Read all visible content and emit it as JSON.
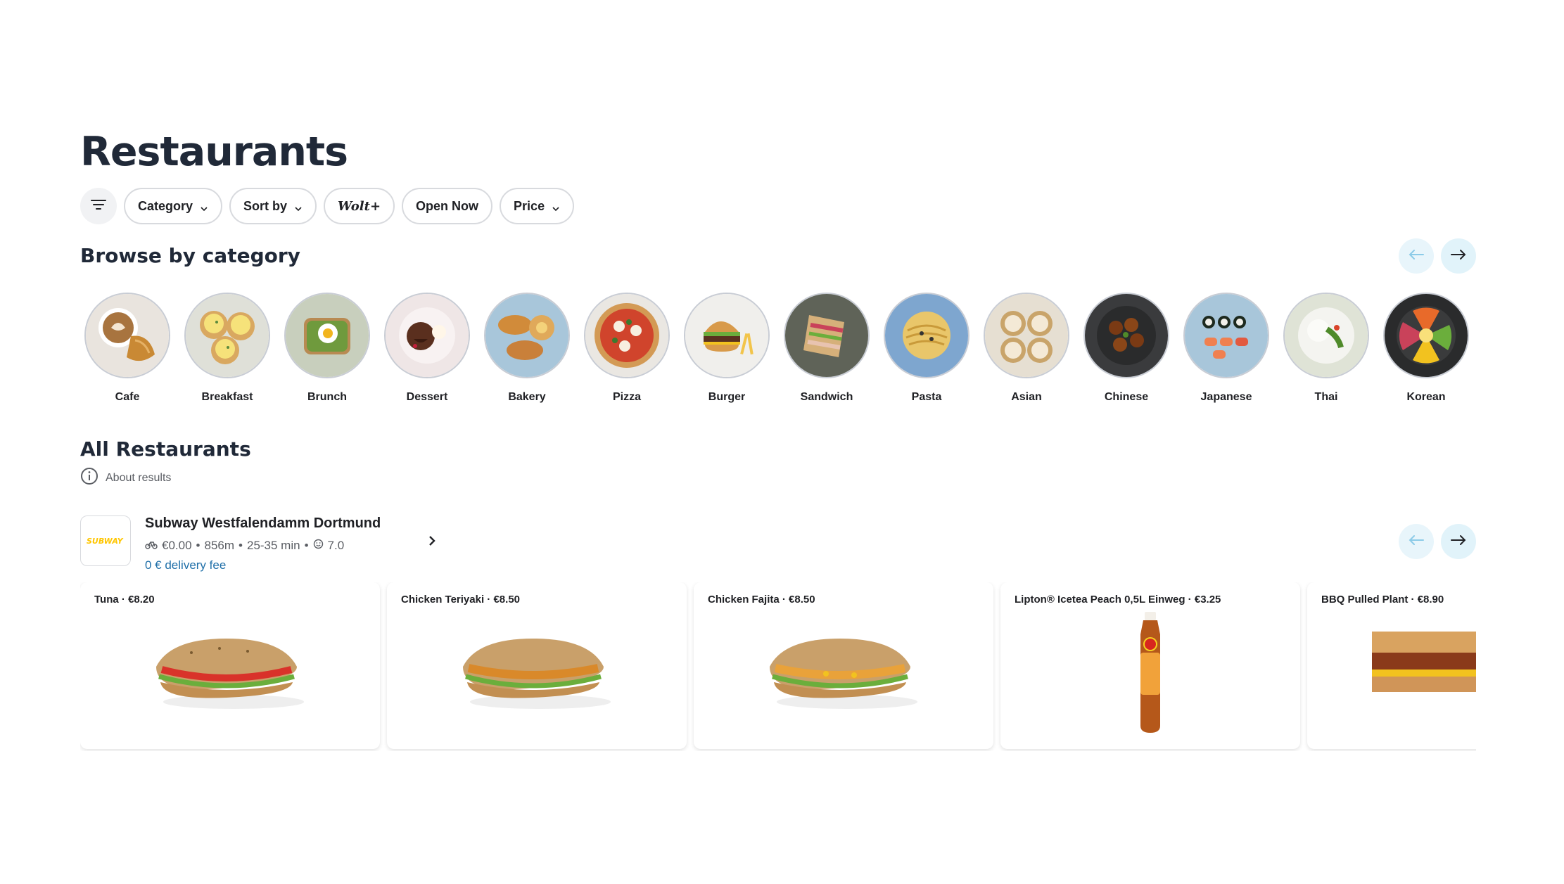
{
  "page": {
    "title": "Restaurants"
  },
  "filters": {
    "icon": "filter-lines-icon",
    "chips": [
      {
        "label": "Category",
        "has_dropdown": true
      },
      {
        "label": "Sort by",
        "has_dropdown": true
      },
      {
        "label": "Wolt+",
        "has_dropdown": false
      },
      {
        "label": "Open Now",
        "has_dropdown": false
      },
      {
        "label": "Price",
        "has_dropdown": true
      }
    ]
  },
  "browse": {
    "title": "Browse by category",
    "categories": [
      {
        "label": "Cafe"
      },
      {
        "label": "Breakfast"
      },
      {
        "label": "Brunch"
      },
      {
        "label": "Dessert"
      },
      {
        "label": "Bakery"
      },
      {
        "label": "Pizza"
      },
      {
        "label": "Burger"
      },
      {
        "label": "Sandwich"
      },
      {
        "label": "Pasta"
      },
      {
        "label": "Asian"
      },
      {
        "label": "Chinese"
      },
      {
        "label": "Japanese"
      },
      {
        "label": "Thai"
      },
      {
        "label": "Korean"
      }
    ]
  },
  "all_restaurants": {
    "title": "All Restaurants",
    "about_label": "About results"
  },
  "venue": {
    "name": "Subway Westfalendamm Dortmund",
    "logo_text": "SUBWAY",
    "delivery_price": "€0.00",
    "distance": "856m",
    "time": "25-35 min",
    "rating": "7.0",
    "fee_note": "0 € delivery fee",
    "items": [
      {
        "name": "Tuna",
        "price": "€8.20"
      },
      {
        "name": "Chicken Teriyaki",
        "price": "€8.50"
      },
      {
        "name": "Chicken Fajita",
        "price": "€8.50"
      },
      {
        "name": "Lipton® Icetea Peach 0,5L Einweg",
        "price": "€3.25"
      },
      {
        "name": "BBQ Pulled Plant",
        "price": "€8.90"
      }
    ]
  },
  "colors": {
    "accent": "#009de0",
    "title": "#202938",
    "nav_bg": "#e1f3fa",
    "subway_green": "#008938",
    "subway_yellow": "#ffc600"
  }
}
